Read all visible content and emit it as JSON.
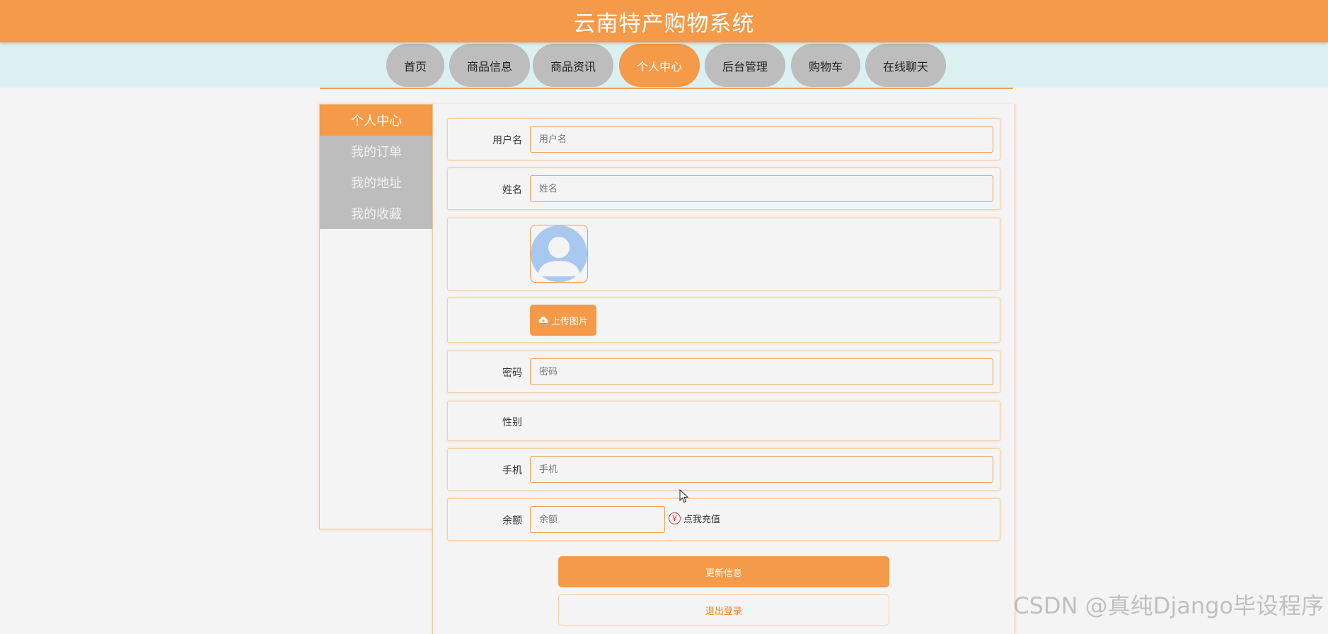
{
  "header": {
    "title": "云南特产购物系统"
  },
  "nav": {
    "items": [
      {
        "label": "首页",
        "active": false
      },
      {
        "label": "商品信息",
        "active": false
      },
      {
        "label": "商品资讯",
        "active": false
      },
      {
        "label": "个人中心",
        "active": true
      },
      {
        "label": "后台管理",
        "active": false
      },
      {
        "label": "购物车",
        "active": false
      },
      {
        "label": "在线聊天",
        "active": false
      }
    ]
  },
  "sidebar": {
    "items": [
      {
        "label": "个人中心",
        "active": true
      },
      {
        "label": "我的订单",
        "active": false
      },
      {
        "label": "我的地址",
        "active": false
      },
      {
        "label": "我的收藏",
        "active": false
      }
    ]
  },
  "form": {
    "username": {
      "label": "用户名",
      "placeholder": "用户名",
      "value": ""
    },
    "name": {
      "label": "姓名",
      "placeholder": "姓名",
      "value": ""
    },
    "avatar_icon": "default-avatar-icon",
    "upload": {
      "label": "上传图片",
      "icon": "cloud-upload-icon"
    },
    "password": {
      "label": "密码",
      "placeholder": "密码",
      "value": ""
    },
    "gender": {
      "label": "性别"
    },
    "phone": {
      "label": "手机",
      "placeholder": "手机",
      "value": ""
    },
    "balance": {
      "label": "余额",
      "placeholder": "余额",
      "value": ""
    },
    "recharge": {
      "label": "点我充值",
      "icon": "yen-icon",
      "icon_glyph": "¥"
    },
    "update_button": "更新信息",
    "logout_button": "退出登录"
  },
  "watermark": "CSDN @真纯Django毕设程序",
  "colors": {
    "accent": "#f59a48",
    "nav_inactive": "#bdbdbd",
    "nav_band": "#dcf0f2",
    "background": "#f4f4f4",
    "recharge_icon": "#e03b3b"
  }
}
